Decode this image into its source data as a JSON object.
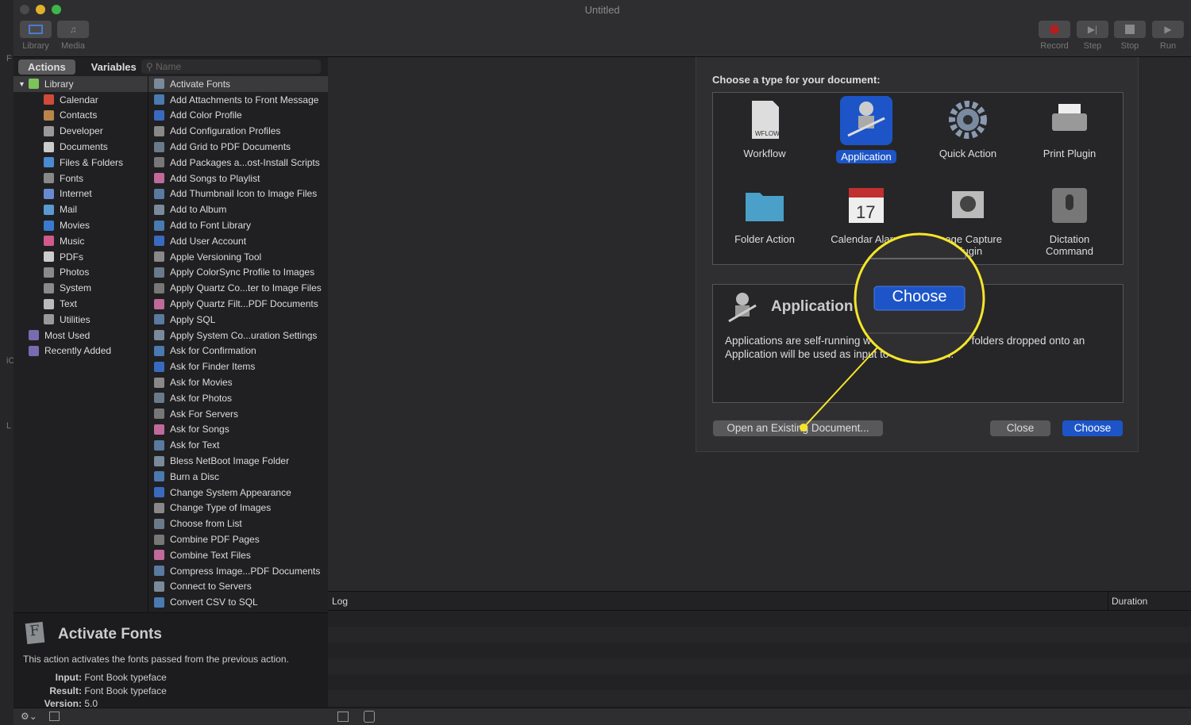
{
  "window": {
    "title": "Untitled"
  },
  "toolbar": {
    "left": [
      {
        "label": "Library",
        "icon": "library-icon"
      },
      {
        "label": "Media",
        "icon": "media-icon"
      }
    ],
    "right": [
      {
        "label": "Record",
        "icon": "record-icon"
      },
      {
        "label": "Step",
        "icon": "step-icon"
      },
      {
        "label": "Stop",
        "icon": "stop-icon"
      },
      {
        "label": "Run",
        "icon": "run-icon"
      }
    ]
  },
  "tabs": {
    "actions": "Actions",
    "variables": "Variables",
    "search_placeholder": "Name"
  },
  "library": [
    {
      "label": "Library",
      "color": "#7cc35a",
      "level": 0,
      "expanded": true
    },
    {
      "label": "Calendar",
      "color": "#d04a3a",
      "level": 1
    },
    {
      "label": "Contacts",
      "color": "#b8864a",
      "level": 1
    },
    {
      "label": "Developer",
      "color": "#999999",
      "level": 1
    },
    {
      "label": "Documents",
      "color": "#cccccc",
      "level": 1
    },
    {
      "label": "Files & Folders",
      "color": "#4a8ad0",
      "level": 1
    },
    {
      "label": "Fonts",
      "color": "#888888",
      "level": 1
    },
    {
      "label": "Internet",
      "color": "#6a8ad0",
      "level": 1
    },
    {
      "label": "Mail",
      "color": "#5a9ad0",
      "level": 1
    },
    {
      "label": "Movies",
      "color": "#3a7ad0",
      "level": 1
    },
    {
      "label": "Music",
      "color": "#d05a8a",
      "level": 1
    },
    {
      "label": "PDFs",
      "color": "#cccccc",
      "level": 1
    },
    {
      "label": "Photos",
      "color": "#8a8a8a",
      "level": 1
    },
    {
      "label": "System",
      "color": "#8a8a8a",
      "level": 1
    },
    {
      "label": "Text",
      "color": "#bbbbbb",
      "level": 1
    },
    {
      "label": "Utilities",
      "color": "#999999",
      "level": 1
    },
    {
      "label": "Most Used",
      "color": "#7a6ab0",
      "level": 0
    },
    {
      "label": "Recently Added",
      "color": "#7a6ab0",
      "level": 0
    }
  ],
  "actions": [
    "Activate Fonts",
    "Add Attachments to Front Message",
    "Add Color Profile",
    "Add Configuration Profiles",
    "Add Grid to PDF Documents",
    "Add Packages a...ost-Install Scripts",
    "Add Songs to Playlist",
    "Add Thumbnail Icon to Image Files",
    "Add to Album",
    "Add to Font Library",
    "Add User Account",
    "Apple Versioning Tool",
    "Apply ColorSync Profile to Images",
    "Apply Quartz Co...ter to Image Files",
    "Apply Quartz Filt...PDF Documents",
    "Apply SQL",
    "Apply System Co...uration Settings",
    "Ask for Confirmation",
    "Ask for Finder Items",
    "Ask for Movies",
    "Ask for Photos",
    "Ask For Servers",
    "Ask for Songs",
    "Ask for Text",
    "Bless NetBoot Image Folder",
    "Burn a Disc",
    "Change System Appearance",
    "Change Type of Images",
    "Choose from List",
    "Combine PDF Pages",
    "Combine Text Files",
    "Compress Image...PDF Documents",
    "Connect to Servers",
    "Convert CSV to SQL"
  ],
  "description": {
    "title": "Activate Fonts",
    "text": "This action activates the fonts passed from the previous action.",
    "input_label": "Input:",
    "input": "Font Book typeface",
    "result_label": "Result:",
    "result": "Font Book typeface",
    "version_label": "Version:",
    "version": "5.0"
  },
  "log": {
    "col1": "Log",
    "col2": "Duration"
  },
  "dialog": {
    "heading": "Choose a type for your document:",
    "types": [
      {
        "label": "Workflow",
        "icon": "workflow-icon"
      },
      {
        "label": "Application",
        "icon": "application-icon",
        "selected": true
      },
      {
        "label": "Quick Action",
        "icon": "gear-icon"
      },
      {
        "label": "Print Plugin",
        "icon": "printer-icon"
      },
      {
        "label": "Folder Action",
        "icon": "folder-icon"
      },
      {
        "label": "Calendar Alarm",
        "icon": "calendar-icon"
      },
      {
        "label": "Image Capture Plugin",
        "icon": "camera-icon"
      },
      {
        "label": "Dictation Command",
        "icon": "microphone-icon"
      }
    ],
    "info_title": "Application",
    "info_text": "Applications are self-running workflows. Any files or folders dropped onto an Application will be used as input to the workflow.",
    "open_existing": "Open an Existing Document...",
    "close": "Close",
    "choose": "Choose"
  },
  "callout": {
    "label": "Choose",
    "color": "#f5e52a"
  },
  "behind_window": {
    "fragments": [
      "F",
      "iC",
      "L"
    ]
  },
  "colors": {
    "accent": "#1d55c8"
  }
}
